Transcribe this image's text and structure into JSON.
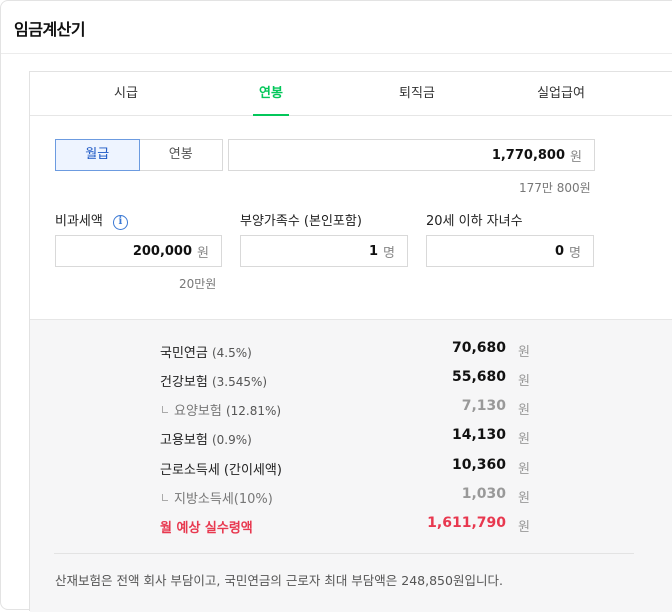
{
  "app": {
    "title": "임금계산기"
  },
  "tabs": [
    {
      "label": "시급",
      "active": false
    },
    {
      "label": "연봉",
      "active": true
    },
    {
      "label": "퇴직금",
      "active": false
    },
    {
      "label": "실업급여",
      "active": false
    }
  ],
  "pay_type": {
    "monthly": "월급",
    "annual": "연봉",
    "selected": "월급"
  },
  "salary": {
    "value": "1,770,800",
    "unit": "원",
    "hint": "177만 800원"
  },
  "nontax": {
    "label": "비과세액",
    "info_icon": "i",
    "value": "200,000",
    "unit": "원",
    "hint": "20만원"
  },
  "dependents": {
    "label": "부양가족수 (본인포함)",
    "value": "1",
    "unit": "명"
  },
  "children": {
    "label": "20세 이하 자녀수",
    "value": "0",
    "unit": "명"
  },
  "results": [
    {
      "label": "국민연금",
      "pct": "(4.5%)",
      "value": "70,680",
      "unit": "원",
      "kind": "main"
    },
    {
      "label": "건강보험",
      "pct": "(3.545%)",
      "value": "55,680",
      "unit": "원",
      "kind": "main"
    },
    {
      "label": "요양보험",
      "pct": "(12.81%)",
      "value": "7,130",
      "unit": "원",
      "kind": "sub"
    },
    {
      "label": "고용보험",
      "pct": "(0.9%)",
      "value": "14,130",
      "unit": "원",
      "kind": "main"
    },
    {
      "label": "근로소득세 (간이세액)",
      "pct": "",
      "value": "10,360",
      "unit": "원",
      "kind": "main"
    },
    {
      "label": "지방소득세(10%)",
      "pct": "",
      "value": "1,030",
      "unit": "원",
      "kind": "sub"
    },
    {
      "label": "월 예상 실수령액",
      "pct": "",
      "value": "1,611,790",
      "unit": "원",
      "kind": "net"
    }
  ],
  "note": "산재보험은 전액 회사 부담이고, 국민연금의 근로자 최대 부담액은 248,850원입니다.",
  "colors": {
    "accent_green": "#03c75a",
    "net_red": "#e8384f",
    "select_blue": "#1a56c4"
  }
}
